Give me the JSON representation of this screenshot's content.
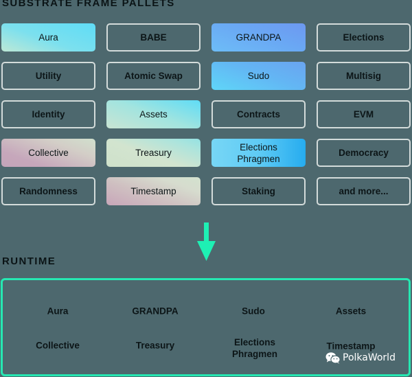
{
  "sections": {
    "pallets_title": "SUBSTRATE FRAME PALLETS",
    "runtime_title": "RUNTIME"
  },
  "pallets": [
    {
      "label": "Aura",
      "style": "gradient",
      "gradient": "aura"
    },
    {
      "label": "BABE",
      "style": "outline"
    },
    {
      "label": "GRANDPA",
      "style": "gradient",
      "gradient": "grandpa"
    },
    {
      "label": "Elections",
      "style": "outline"
    },
    {
      "label": "Utility",
      "style": "outline"
    },
    {
      "label": "Atomic Swap",
      "style": "outline"
    },
    {
      "label": "Sudo",
      "style": "gradient",
      "gradient": "sudo"
    },
    {
      "label": "Multisig",
      "style": "outline"
    },
    {
      "label": "Identity",
      "style": "outline"
    },
    {
      "label": "Assets",
      "style": "gradient",
      "gradient": "assets"
    },
    {
      "label": "Contracts",
      "style": "outline"
    },
    {
      "label": "EVM",
      "style": "outline"
    },
    {
      "label": "Collective",
      "style": "gradient",
      "gradient": "collective"
    },
    {
      "label": "Treasury",
      "style": "gradient",
      "gradient": "treasury"
    },
    {
      "label": "Elections\nPhragmen",
      "style": "gradient",
      "gradient": "elections"
    },
    {
      "label": "Democracy",
      "style": "outline"
    },
    {
      "label": "Randomness",
      "style": "outline"
    },
    {
      "label": "Timestamp",
      "style": "gradient",
      "gradient": "timestamp"
    },
    {
      "label": "Staking",
      "style": "outline"
    },
    {
      "label": "and more...",
      "style": "outline"
    }
  ],
  "arrow": {
    "icon": "arrow-down-icon",
    "color": "#1ef0b4"
  },
  "runtime": {
    "border_color": "#26e8b2",
    "items": [
      {
        "label": "Aura"
      },
      {
        "label": "GRANDPA"
      },
      {
        "label": "Sudo"
      },
      {
        "label": "Assets"
      },
      {
        "label": "Collective"
      },
      {
        "label": "Treasury"
      },
      {
        "label": "Elections\nPhragmen"
      },
      {
        "label": "Timestamp"
      }
    ]
  },
  "watermark": {
    "icon": "wechat-icon",
    "text": "PolkaWorld"
  }
}
